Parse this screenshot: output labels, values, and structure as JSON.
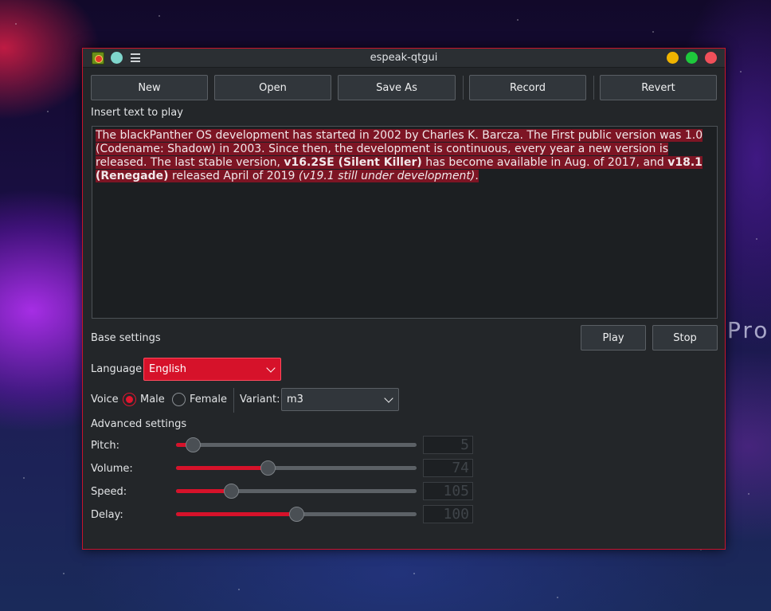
{
  "background": {
    "partial_text": "Pro"
  },
  "window": {
    "title": "espeak-qtgui",
    "accent_color": "#d6122a"
  },
  "toolbar": {
    "new_label": "New",
    "open_label": "Open",
    "save_as_label": "Save As",
    "record_label": "Record",
    "revert_label": "Revert"
  },
  "editor": {
    "label": "Insert text to play",
    "segments": [
      "The blackPanther OS development has started in 2002 by Charles K. Barcza. The First public version was 1.0 (Codename: Shadow) in 2003. Since then, the development is continuous, every year a new version is released. The last stable version,  ",
      "v16.2SE (Silent Killer)",
      " has become available in Aug. of 2017, and ",
      "v18.1 (Renegade)",
      " released April of 2019 ",
      "(v19.1 still under development)",
      "."
    ]
  },
  "base_settings": {
    "label": "Base settings",
    "play_label": "Play",
    "stop_label": "Stop",
    "language_label": "Language",
    "language_value": "English",
    "voice_label": "Voice",
    "voice_male": "Male",
    "voice_female": "Female",
    "voice_selected": "Male",
    "variant_label": "Variant:",
    "variant_value": "m3"
  },
  "advanced_settings": {
    "label": "Advanced settings",
    "sliders": [
      {
        "name": "pitch",
        "label": "Pitch:",
        "fraction": 0.07,
        "readout": "5"
      },
      {
        "name": "volume",
        "label": "Volume:",
        "fraction": 0.38,
        "readout": "74"
      },
      {
        "name": "speed",
        "label": "Speed:",
        "fraction": 0.23,
        "readout": "105"
      },
      {
        "name": "delay",
        "label": "Delay:",
        "fraction": 0.5,
        "readout": "100"
      }
    ]
  }
}
